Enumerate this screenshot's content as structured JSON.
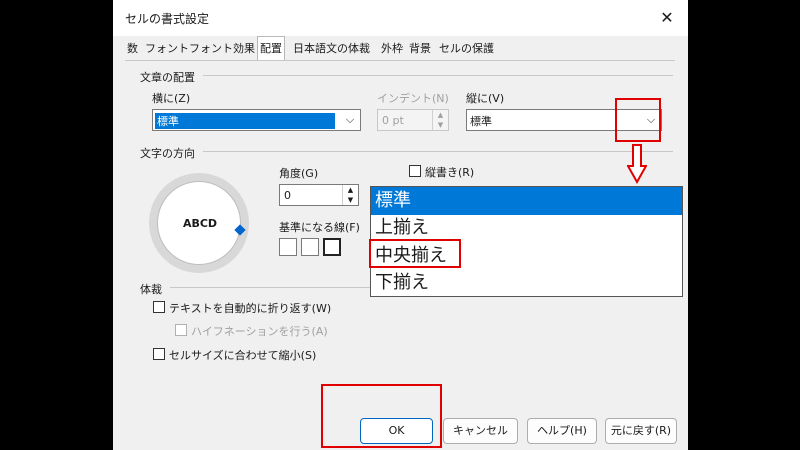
{
  "window": {
    "title": "セルの書式設定",
    "close": "✕"
  },
  "tabs": [
    {
      "label": "数"
    },
    {
      "label": "フォント"
    },
    {
      "label": "フォント効果"
    },
    {
      "label": "配置"
    },
    {
      "label": "日本語文の体裁"
    },
    {
      "label": "外枠"
    },
    {
      "label": "背景"
    },
    {
      "label": "セルの保護"
    }
  ],
  "text_alignment": {
    "section_label": "文章の配置",
    "horizontal_label": "横に(Z)",
    "horizontal_value": "標準",
    "indent_label": "インデント(N)",
    "indent_value": "0 pt",
    "vertical_label": "縦に(V)",
    "vertical_value": "標準"
  },
  "text_direction": {
    "section_label": "文字の方向",
    "dial_text": "ABCD",
    "angle_label": "角度(G)",
    "angle_value": "0",
    "vertical_stack_label": "縦書き(R)",
    "reference_edge_label": "基準になる線(F)"
  },
  "dropdown": {
    "options": [
      "標準",
      "上揃え",
      "中央揃え",
      "下揃え"
    ],
    "highlighted": "標準",
    "annotated": "中央揃え"
  },
  "properties": {
    "section_label": "体裁",
    "wrap_label": "テキストを自動的に折り返す(W)",
    "hyphenation_label": "ハイフネーションを行う(A)",
    "shrink_label": "セルサイズに合わせて縮小(S)"
  },
  "footer": {
    "ok": "OK",
    "cancel": "キャンセル",
    "help": "ヘルプ(H)",
    "reset": "元に戻す(R)"
  },
  "colors": {
    "highlight": "#0078d7",
    "annotation": "#e00000"
  }
}
